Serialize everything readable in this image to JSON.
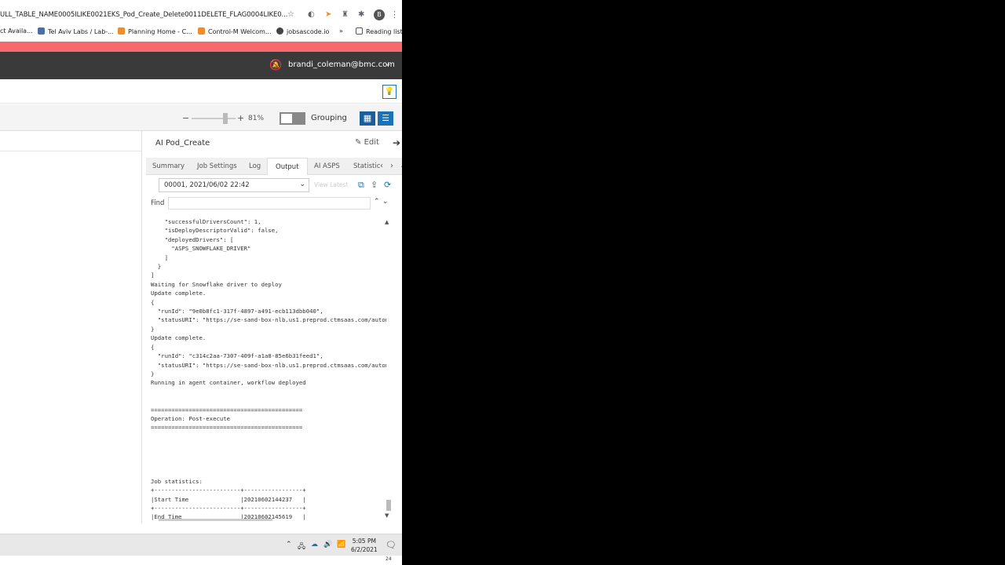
{
  "browser": {
    "url": "ULL_TABLE_NAME0005ILIKE0021EKS_Pod_Create_Delete0011DELETE_FLAG0004LIKE0...",
    "profile_initial": "B",
    "bookmarks": [
      {
        "label": "ct Availa...",
        "color": "#888888"
      },
      {
        "label": "Tel Aviv Labs / Lab-...",
        "color": "#4a6fa5"
      },
      {
        "label": "Planning Home - C...",
        "color": "#f28c28"
      },
      {
        "label": "Control-M Welcom...",
        "color": "#f28c28"
      },
      {
        "label": "jobsascode.io",
        "color": "#444444"
      },
      {
        "label": "»",
        "color": ""
      },
      {
        "label": "Reading list",
        "color": "#555555"
      }
    ]
  },
  "header": {
    "user": "brandi_coleman@bmc.com"
  },
  "toolbar": {
    "zoom": "81%",
    "grouping_label": "Grouping",
    "minus": "−",
    "plus": "+"
  },
  "detail": {
    "title": "AI Pod_Create",
    "edit_label": "Edit",
    "tabs": [
      "Summary",
      "Job Settings",
      "Log",
      "Output",
      "AI ASPS",
      "Statistic"
    ],
    "active_tab": "Output",
    "run_selected": "00001, 2021/06/02 22:42",
    "view_latest": "View Latest",
    "find_label": "Find",
    "find_value": ""
  },
  "output_lines": [
    "    \"successfulDriversCount\": 1,",
    "    \"isDeployDescriptorValid\": false,",
    "    \"deployedDrivers\": [",
    "      \"ASPS_SNOWFLAKE_DRIVER\"",
    "    ]",
    "  }",
    "]",
    "Waiting for Snowflake driver to deploy",
    "Update complete.",
    "{",
    "  \"runId\": \"9e0b8fc1-317f-4897-a491-ecb113dbb040\",",
    "  \"statusURI\": \"https://se-sand-box-nlb.us1.preprod.ctmsaas.com/autom",
    "}",
    "Update complete.",
    "{",
    "  \"runId\": \"c314c2aa-7307-409f-a1a8-85e6b31feed1\",",
    "  \"statusURI\": \"https://se-sand-box-nlb.us1.preprod.ctmsaas.com/autom",
    "}",
    "Running in agent container, workflow deployed",
    "",
    "",
    "============================================",
    "Operation: Post-execute",
    "============================================",
    "",
    "",
    "",
    "",
    "",
    "Job statistics:",
    "+-------------------------+-----------------+",
    "|Start Time               |20210602144237   |",
    "+-------------------------+-----------------+",
    "|End Time                 |20210602145619   |"
  ],
  "taskbar": {
    "time": "5:05 PM",
    "date": "6/2/2021",
    "notif_count": "24"
  }
}
